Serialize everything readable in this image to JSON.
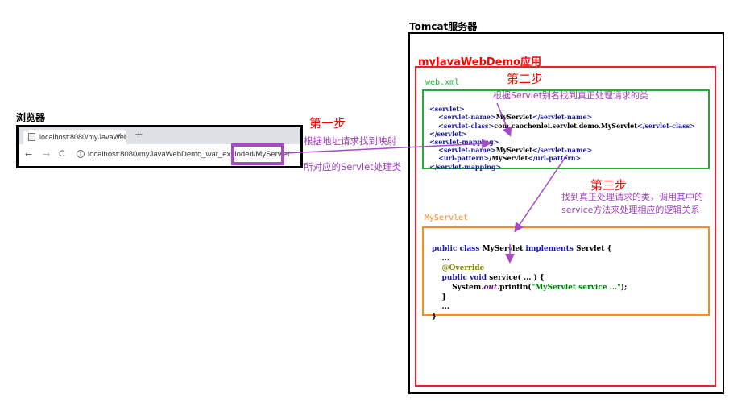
{
  "browser": {
    "title": "浏览器",
    "tab_title": "localhost:8080/myJavaWebDe",
    "tab_close": "×",
    "new_tab": "+",
    "back": "←",
    "forward": "→",
    "reload": "C",
    "info": "i",
    "url": "localhost:8080/myJavaWebDemo_war_exploded/MyServlet"
  },
  "tomcat": {
    "title": "Tomcat服务器",
    "app_title": "myJavaWebDemo应用",
    "web_xml_label": "web.xml",
    "servlet_label": "MyServlet"
  },
  "steps": {
    "step1": "第一步",
    "step1_note_line1": "根据地址请求找到映射",
    "step1_note_line2": "所对应的Servlet处理类",
    "step2": "第二步",
    "step2_note": "根据Servlet别名找到真正处理请求的类",
    "step3": "第三步",
    "step3_note_line1": "找到真正处理请求的类，调用其中的",
    "step3_note_line2": "service方法来处理相应的逻辑关系"
  },
  "web_xml": {
    "l1_tag": "<servlet>",
    "l2_open": "<servlet-name>",
    "l2_text": "MyServlet",
    "l2_close": "</servlet-name>",
    "l3_open": "<servlet-class>",
    "l3_text": "com.caochenlei.servlet.demo.MyServlet",
    "l3_close": "</servlet-class>",
    "l4_tag": "</servlet>",
    "l5_tag": "<servlet-mapping>",
    "l6_open": "<servlet-name>",
    "l6_text": "MyServlet",
    "l6_close": "</servlet-name>",
    "l7_open": "<url-pattern>",
    "l7_text": "/MyServlet",
    "l7_close": "</url-pattern>",
    "l8_tag": "</servlet-mapping>"
  },
  "servlet_code": {
    "l1_kw": "public class ",
    "l1_name": "MyServlet ",
    "l1_kw2": "implements ",
    "l1_rest": "Servlet {",
    "l2": "...",
    "l3": "@Override",
    "l4_kw": "public void ",
    "l4_rest": "service( ... ) {",
    "l5_a": "System.",
    "l5_field": "out",
    "l5_b": ".println(",
    "l5_str": "\"MyServlet service ...\"",
    "l5_c": ");",
    "l6": "}",
    "l7": "...",
    "l8": "}"
  },
  "colors": {
    "arrow": "#a64bc4",
    "red": "#e8222a",
    "green": "#22aa3a",
    "orange": "#ff8a1f"
  }
}
